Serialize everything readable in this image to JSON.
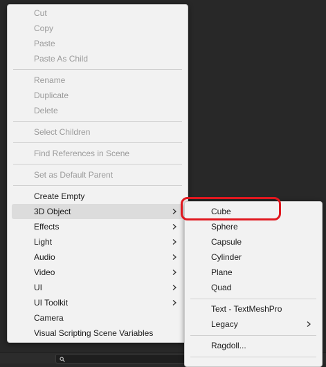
{
  "main_menu": {
    "items": [
      {
        "label": "Cut",
        "disabled": true
      },
      {
        "label": "Copy",
        "disabled": true
      },
      {
        "label": "Paste",
        "disabled": true
      },
      {
        "label": "Paste As Child",
        "disabled": true
      },
      {
        "label": "Rename",
        "disabled": true
      },
      {
        "label": "Duplicate",
        "disabled": true
      },
      {
        "label": "Delete",
        "disabled": true
      },
      {
        "label": "Select Children",
        "disabled": true
      },
      {
        "label": "Find References in Scene",
        "disabled": true
      },
      {
        "label": "Set as Default Parent",
        "disabled": true
      },
      {
        "label": "Create Empty",
        "disabled": false
      },
      {
        "label": "3D Object",
        "disabled": false,
        "submenu": true,
        "highlighted": true
      },
      {
        "label": "Effects",
        "disabled": false,
        "submenu": true
      },
      {
        "label": "Light",
        "disabled": false,
        "submenu": true
      },
      {
        "label": "Audio",
        "disabled": false,
        "submenu": true
      },
      {
        "label": "Video",
        "disabled": false,
        "submenu": true
      },
      {
        "label": "UI",
        "disabled": false,
        "submenu": true
      },
      {
        "label": "UI Toolkit",
        "disabled": false,
        "submenu": true
      },
      {
        "label": "Camera",
        "disabled": false
      },
      {
        "label": "Visual Scripting Scene Variables",
        "disabled": false
      }
    ]
  },
  "sub_menu": {
    "items": [
      {
        "label": "Cube",
        "annotated": true
      },
      {
        "label": "Sphere"
      },
      {
        "label": "Capsule"
      },
      {
        "label": "Cylinder"
      },
      {
        "label": "Plane"
      },
      {
        "label": "Quad"
      },
      {
        "label": "Text - TextMeshPro"
      },
      {
        "label": "Legacy",
        "submenu": true
      },
      {
        "label": "Ragdoll..."
      }
    ]
  },
  "colors": {
    "menu_bg": "#f2f2f2",
    "highlight_bg": "#dcdcdc",
    "disabled_text": "#9a9a9a",
    "annotation_red": "#e0181f"
  },
  "icons": {
    "submenu_arrow": "chevron-right-icon",
    "search": "search-icon"
  }
}
